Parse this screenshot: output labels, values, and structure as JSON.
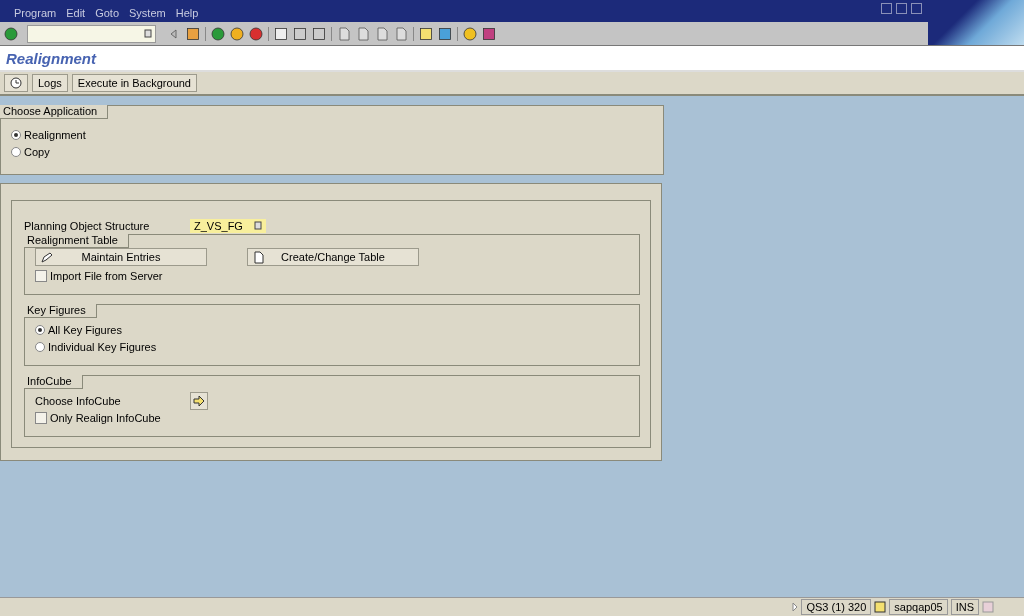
{
  "menu": [
    "Program",
    "Edit",
    "Goto",
    "System",
    "Help"
  ],
  "title": "Realignment",
  "app_toolbar": {
    "buttons": [
      "Logs",
      "Execute in Background"
    ]
  },
  "choose_application": {
    "title": "Choose Application",
    "options": [
      {
        "label": "Realignment",
        "selected": true
      },
      {
        "label": "Copy",
        "selected": false
      }
    ]
  },
  "planning_object_structure": {
    "label": "Planning Object Structure",
    "value": "Z_VS_FG"
  },
  "realignment_table": {
    "title": "Realignment Table",
    "buttons": [
      "Maintain Entries",
      "Create/Change Table"
    ],
    "import_file": {
      "label": "Import File from Server",
      "checked": false
    }
  },
  "key_figures": {
    "title": "Key Figures",
    "options": [
      {
        "label": "All Key Figures",
        "selected": true
      },
      {
        "label": "Individual Key Figures",
        "selected": false
      }
    ]
  },
  "infocube": {
    "title": "InfoCube",
    "choose_label": "Choose InfoCube",
    "only_realign": {
      "label": "Only Realign InfoCube",
      "checked": false
    }
  },
  "status_bar": {
    "system": "QS3 (1) 320",
    "server": "sapqap05",
    "mode": "INS"
  }
}
